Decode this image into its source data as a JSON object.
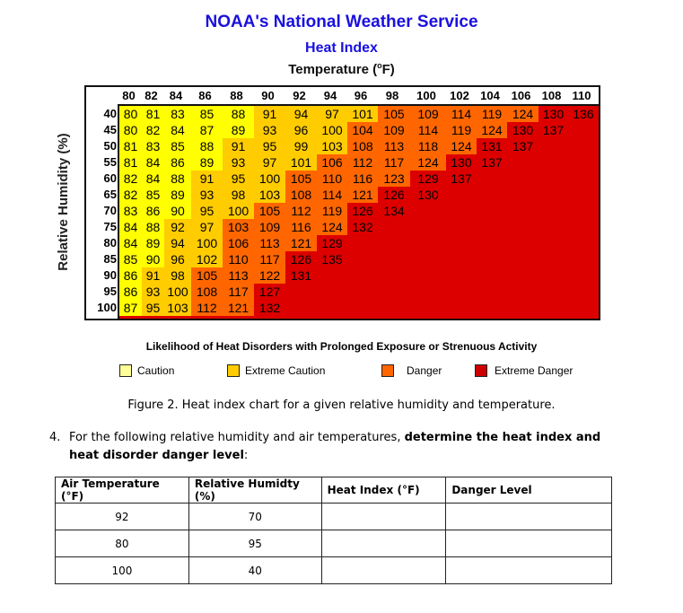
{
  "header": {
    "org": "NOAA's National Weather Service",
    "title": "Heat Index",
    "temp_label": "Temperature (",
    "temp_degree": "o",
    "temp_unit": "F)"
  },
  "chart_data": {
    "type": "heatmap",
    "title": "Heat Index",
    "xlabel": "Temperature (°F)",
    "ylabel": "Relative Humidity (%)",
    "x": [
      80,
      82,
      84,
      86,
      88,
      90,
      92,
      94,
      96,
      98,
      100,
      102,
      104,
      106,
      108,
      110
    ],
    "y": [
      40,
      45,
      50,
      55,
      60,
      65,
      70,
      75,
      80,
      85,
      90,
      95,
      100
    ],
    "categories": {
      "C": {
        "label": "Caution",
        "color": "#ffff00"
      },
      "EC": {
        "label": "Extreme Caution",
        "color": "#ffcc00"
      },
      "D": {
        "label": "Danger",
        "color": "#ff6600"
      },
      "ED": {
        "label": "Extreme Danger",
        "color": "#dd0000"
      }
    },
    "rows": [
      {
        "rh": 40,
        "values": [
          80,
          81,
          83,
          85,
          88,
          91,
          94,
          97,
          101,
          105,
          109,
          114,
          119,
          124,
          130,
          136
        ],
        "levels": [
          "C",
          "C",
          "C",
          "C",
          "C",
          "EC",
          "EC",
          "EC",
          "EC",
          "D",
          "D",
          "D",
          "D",
          "D",
          "ED",
          "ED"
        ]
      },
      {
        "rh": 45,
        "values": [
          80,
          82,
          84,
          87,
          89,
          93,
          96,
          100,
          104,
          109,
          114,
          119,
          124,
          130,
          137
        ],
        "levels": [
          "C",
          "C",
          "C",
          "C",
          "C",
          "EC",
          "EC",
          "EC",
          "D",
          "D",
          "D",
          "D",
          "D",
          "ED",
          "ED"
        ]
      },
      {
        "rh": 50,
        "values": [
          81,
          83,
          85,
          88,
          91,
          95,
          99,
          103,
          108,
          113,
          118,
          124,
          131,
          137
        ],
        "levels": [
          "C",
          "C",
          "C",
          "C",
          "EC",
          "EC",
          "EC",
          "EC",
          "D",
          "D",
          "D",
          "D",
          "ED",
          "ED"
        ]
      },
      {
        "rh": 55,
        "values": [
          81,
          84,
          86,
          89,
          93,
          97,
          101,
          106,
          112,
          117,
          124,
          130,
          137
        ],
        "levels": [
          "C",
          "C",
          "C",
          "C",
          "EC",
          "EC",
          "EC",
          "D",
          "D",
          "D",
          "D",
          "ED",
          "ED"
        ]
      },
      {
        "rh": 60,
        "values": [
          82,
          84,
          88,
          91,
          95,
          100,
          105,
          110,
          116,
          123,
          129,
          137
        ],
        "levels": [
          "C",
          "C",
          "C",
          "EC",
          "EC",
          "EC",
          "D",
          "D",
          "D",
          "D",
          "ED",
          "ED"
        ]
      },
      {
        "rh": 65,
        "values": [
          82,
          85,
          89,
          93,
          98,
          103,
          108,
          114,
          121,
          126,
          130
        ],
        "levels": [
          "C",
          "C",
          "C",
          "EC",
          "EC",
          "EC",
          "D",
          "D",
          "D",
          "ED",
          "ED"
        ]
      },
      {
        "rh": 70,
        "values": [
          83,
          86,
          90,
          95,
          100,
          105,
          112,
          119,
          126,
          134
        ],
        "levels": [
          "C",
          "C",
          "C",
          "EC",
          "EC",
          "D",
          "D",
          "D",
          "ED",
          "ED"
        ]
      },
      {
        "rh": 75,
        "values": [
          84,
          88,
          92,
          97,
          103,
          109,
          116,
          124,
          132
        ],
        "levels": [
          "C",
          "C",
          "EC",
          "EC",
          "D",
          "D",
          "D",
          "D",
          "ED"
        ]
      },
      {
        "rh": 80,
        "values": [
          84,
          89,
          94,
          100,
          106,
          113,
          121,
          129
        ],
        "levels": [
          "C",
          "C",
          "EC",
          "EC",
          "D",
          "D",
          "D",
          "ED"
        ]
      },
      {
        "rh": 85,
        "values": [
          85,
          90,
          96,
          102,
          110,
          117,
          126,
          135
        ],
        "levels": [
          "C",
          "C",
          "EC",
          "EC",
          "D",
          "D",
          "ED",
          "ED"
        ]
      },
      {
        "rh": 90,
        "values": [
          86,
          91,
          98,
          105,
          113,
          122,
          131
        ],
        "levels": [
          "C",
          "EC",
          "EC",
          "D",
          "D",
          "D",
          "ED"
        ]
      },
      {
        "rh": 95,
        "values": [
          86,
          93,
          100,
          108,
          117,
          127
        ],
        "levels": [
          "C",
          "EC",
          "EC",
          "D",
          "D",
          "ED"
        ]
      },
      {
        "rh": 100,
        "values": [
          87,
          95,
          103,
          112,
          121,
          132
        ],
        "levels": [
          "C",
          "EC",
          "EC",
          "D",
          "D",
          "ED"
        ]
      }
    ]
  },
  "ylabel": "Relative Humidity (%)",
  "legend": {
    "title": "Likelihood of Heat Disorders with Prolonged Exposure or Strenuous Activity",
    "items": [
      {
        "label": "Caution",
        "color": "#ffff99"
      },
      {
        "label": "Extreme Caution",
        "color": "#ffcc00"
      },
      {
        "label": "Danger",
        "color": "#ff6600"
      },
      {
        "label": "Extreme Danger",
        "color": "#cc0000"
      }
    ]
  },
  "caption": "Figure 2.  Heat index chart for a given relative humidity and temperature.",
  "question": {
    "number": "4.",
    "text_plain": "For the following relative humidity and air temperatures, ",
    "text_bold": "determine the heat index and heat disorder danger level",
    "text_end": ":"
  },
  "table": {
    "headers": [
      "Air Temperature (°F)",
      "Relative Humidty (%)",
      "Heat Index (°F)",
      "Danger Level"
    ],
    "rows": [
      [
        "92",
        "70",
        "",
        ""
      ],
      [
        "80",
        "95",
        "",
        ""
      ],
      [
        "100",
        "40",
        "",
        ""
      ]
    ]
  }
}
